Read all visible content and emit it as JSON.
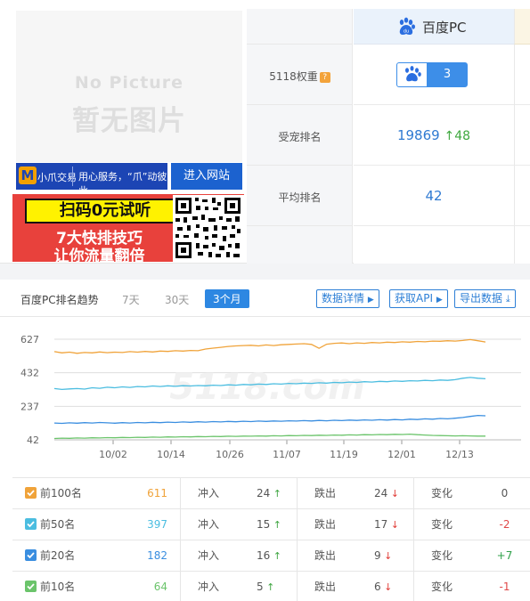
{
  "thumbnail": {
    "placeholder_en": "No Picture",
    "placeholder_zh": "暂无图片"
  },
  "ad_bar": {
    "brand": "小爪交易",
    "slogan": "用心服务，“爪”动彼此",
    "enter_site": "进入网站"
  },
  "ad_banner": {
    "line1": "扫码0元试听",
    "line2": "7大快排技巧",
    "line3": "让你流量翻倍"
  },
  "rank_table": {
    "engine_title": "百度PC",
    "rows": [
      {
        "label": "5118权重",
        "help_icon": "?"
      },
      {
        "label": "受宠排名"
      },
      {
        "label": "平均排名"
      }
    ],
    "weight_value": "3",
    "pet_rank": "19869",
    "pet_rank_change": "48",
    "avg_rank": "42"
  },
  "trend": {
    "title": "百度PC排名趋势",
    "tabs": [
      "7天",
      "30天",
      "3个月"
    ],
    "active_tab": "3个月",
    "buttons": {
      "details": "数据详情",
      "api": "获取API",
      "export": "导出数据"
    },
    "watermark": "5118.com"
  },
  "chart_data": {
    "type": "line",
    "y_ticks": [
      42,
      237,
      432,
      627
    ],
    "x_ticks": [
      "10/02",
      "10/14",
      "10/26",
      "11/07",
      "11/19",
      "12/01",
      "12/13"
    ],
    "ylim": [
      42,
      627
    ],
    "series": [
      {
        "name": "前100名",
        "color": "#f0a33a",
        "values": [
          555,
          548,
          552,
          545,
          550,
          548,
          553,
          549,
          552,
          550,
          555,
          552,
          556,
          553,
          558,
          556,
          560,
          558,
          562,
          560,
          570,
          575,
          580,
          585,
          588,
          590,
          592,
          588,
          594,
          590,
          595,
          597,
          599,
          601,
          597,
          574,
          598,
          603,
          605,
          601,
          606,
          603,
          608,
          606,
          610,
          608,
          612,
          610,
          614,
          612,
          616,
          615,
          618,
          616,
          620,
          625,
          618,
          611
        ]
      },
      {
        "name": "前50名",
        "color": "#4bbde0",
        "values": [
          340,
          335,
          338,
          340,
          337,
          345,
          342,
          348,
          345,
          350,
          347,
          352,
          350,
          355,
          352,
          356,
          353,
          357,
          355,
          358,
          356,
          360,
          358,
          362,
          360,
          364,
          362,
          366,
          364,
          368,
          366,
          370,
          368,
          372,
          370,
          374,
          372,
          376,
          374,
          378,
          376,
          380,
          378,
          382,
          380,
          384,
          382,
          386,
          384,
          388,
          386,
          390,
          388,
          392,
          400,
          405,
          400,
          397
        ]
      },
      {
        "name": "前20名",
        "color": "#3a8ee0",
        "values": [
          140,
          138,
          141,
          139,
          142,
          140,
          143,
          141,
          139,
          142,
          140,
          143,
          141,
          144,
          142,
          145,
          143,
          146,
          144,
          147,
          145,
          148,
          146,
          149,
          147,
          150,
          148,
          151,
          149,
          152,
          150,
          153,
          151,
          154,
          152,
          155,
          153,
          156,
          154,
          157,
          155,
          158,
          156,
          159,
          157,
          160,
          158,
          162,
          160,
          164,
          162,
          166,
          164,
          168,
          172,
          178,
          184,
          182
        ]
      },
      {
        "name": "前10名",
        "color": "#6bc46b",
        "values": [
          50,
          52,
          51,
          53,
          52,
          54,
          53,
          55,
          54,
          56,
          55,
          57,
          56,
          58,
          57,
          59,
          58,
          60,
          59,
          61,
          60,
          62,
          61,
          63,
          62,
          64,
          63,
          65,
          64,
          66,
          65,
          67,
          66,
          68,
          67,
          69,
          68,
          70,
          69,
          71,
          70,
          72,
          71,
          73,
          72,
          74,
          73,
          75,
          72,
          70,
          68,
          67,
          66,
          65,
          66,
          65,
          64,
          64
        ]
      }
    ]
  },
  "stats": {
    "rows": [
      {
        "label": "前100名",
        "value": "611",
        "color": "#f0a33a",
        "in_label": "冲入",
        "in_val": "24",
        "out_label": "跌出",
        "out_val": "24",
        "chg_label": "变化",
        "chg": "0"
      },
      {
        "label": "前50名",
        "value": "397",
        "color": "#4bbde0",
        "in_label": "冲入",
        "in_val": "15",
        "out_label": "跌出",
        "out_val": "17",
        "chg_label": "变化",
        "chg": "-2"
      },
      {
        "label": "前20名",
        "value": "182",
        "color": "#3a8ee0",
        "in_label": "冲入",
        "in_val": "16",
        "out_label": "跌出",
        "out_val": "9",
        "chg_label": "变化",
        "chg": "+7"
      },
      {
        "label": "前10名",
        "value": "64",
        "color": "#6bc46b",
        "in_label": "冲入",
        "in_val": "5",
        "out_label": "跌出",
        "out_val": "6",
        "chg_label": "变化",
        "chg": "-1"
      }
    ]
  }
}
